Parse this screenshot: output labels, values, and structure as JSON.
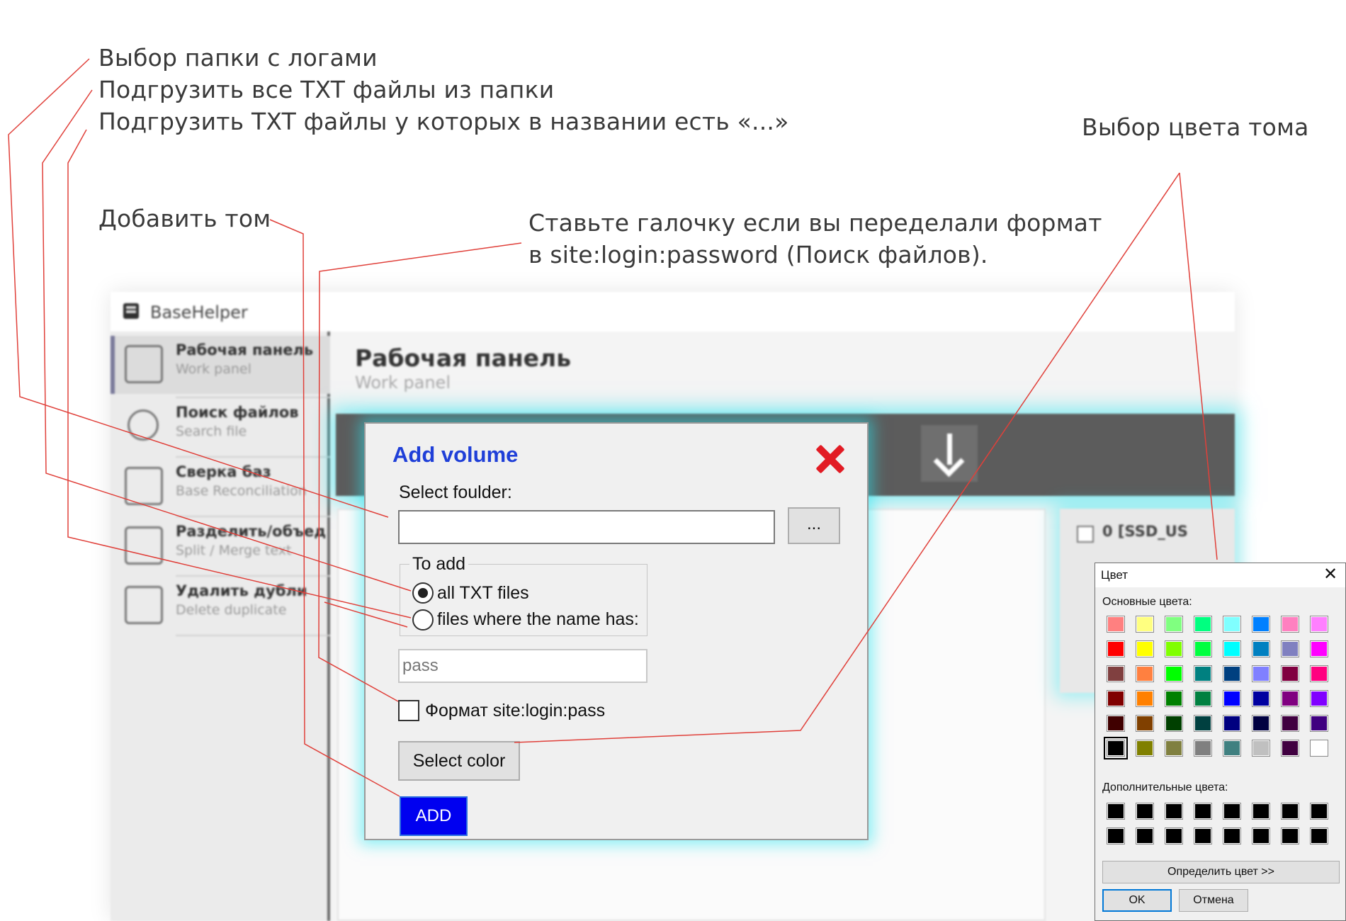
{
  "annotations": {
    "select_logs_folder": "Выбор папки с логами",
    "load_all_txt": "Подгрузить все TXT файлы из папки",
    "load_txt_with_name": "Подгрузить TXT файлы у которых в названии есть «...»",
    "select_volume_color": "Выбор цвета тома",
    "add_volume": "Добавить том",
    "format_hint_line1": "Ставьте галочку если вы переделали формат",
    "format_hint_line2": "в site:login:password (Поиск файлов)."
  },
  "app": {
    "title": "BaseHelper",
    "nav": [
      {
        "title": "Рабочая панель",
        "subtitle": "Work panel",
        "icon": "sliders-icon"
      },
      {
        "title": "Поиск файлов",
        "subtitle": "Search file",
        "icon": "magnifier-icon"
      },
      {
        "title": "Сверка баз",
        "subtitle": "Base Reconciliation",
        "icon": "compare-icon"
      },
      {
        "title": "Разделить/объед",
        "subtitle": "Split / Merge text",
        "icon": "split-merge-icon"
      },
      {
        "title": "Удалить дубли",
        "subtitle": "Delete duplicate",
        "icon": "delete-duplicate-icon"
      }
    ],
    "page_title": "Рабочая панель",
    "page_subtitle": "Work panel",
    "volume_label": "0 [SSD_US"
  },
  "add_volume_dialog": {
    "title": "Add volume",
    "folder_label": "Select foulder:",
    "folder_value": "",
    "browse_label": "...",
    "group_label": "To add",
    "radio_all": "all TXT files",
    "radio_name": "files where the name has:",
    "radio_selected": "all TXT files",
    "name_filter_value": "pass",
    "format_checkbox_label": "Формат site:login:pass",
    "format_checked": false,
    "select_color_label": "Select color",
    "add_label": "ADD",
    "accent_color": "#0000f0",
    "title_color": "#1f3fd8",
    "close_color": "#e21b24"
  },
  "color_dialog": {
    "title": "Цвет",
    "close_label": "✕",
    "basic_colors_label": "Основные цвета:",
    "custom_colors_label": "Дополнительные цвета:",
    "define_color_label": "Определить цвет >>",
    "ok_label": "OK",
    "cancel_label": "Отмена",
    "selected_color": "#000000",
    "basic_colors": [
      [
        "#ff8080",
        "#ffff80",
        "#80ff80",
        "#00ff80",
        "#80ffff",
        "#0080ff",
        "#ff80c0",
        "#ff80ff"
      ],
      [
        "#ff0000",
        "#ffff00",
        "#80ff00",
        "#00ff40",
        "#00ffff",
        "#0080c0",
        "#8080c0",
        "#ff00ff"
      ],
      [
        "#804040",
        "#ff8040",
        "#00ff00",
        "#008080",
        "#004080",
        "#8080ff",
        "#800040",
        "#ff0080"
      ],
      [
        "#800000",
        "#ff8000",
        "#008000",
        "#008040",
        "#0000ff",
        "#0000a0",
        "#800080",
        "#8000ff"
      ],
      [
        "#400000",
        "#804000",
        "#004000",
        "#004040",
        "#000080",
        "#000040",
        "#400040",
        "#400080"
      ],
      [
        "#000000",
        "#808000",
        "#808040",
        "#808080",
        "#408080",
        "#c0c0c0",
        "#400040",
        "#ffffff"
      ]
    ],
    "custom_colors": [
      [
        "#000000",
        "#000000",
        "#000000",
        "#000000",
        "#000000",
        "#000000",
        "#000000",
        "#000000"
      ],
      [
        "#000000",
        "#000000",
        "#000000",
        "#000000",
        "#000000",
        "#000000",
        "#000000",
        "#000000"
      ]
    ]
  },
  "leader_color": "#e0403a"
}
